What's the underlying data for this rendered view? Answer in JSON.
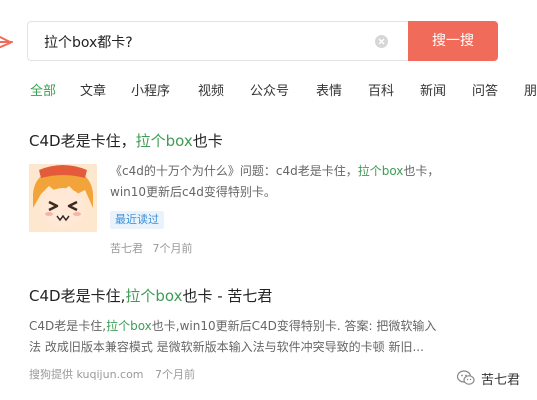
{
  "search": {
    "query": "拉个box都卡?",
    "button_label": "搜一搜"
  },
  "tabs": [
    {
      "label": "全部",
      "active": true
    },
    {
      "label": "文章"
    },
    {
      "label": "小程序"
    },
    {
      "label": "视频"
    },
    {
      "label": "公众号"
    },
    {
      "label": "表情"
    },
    {
      "label": "百科"
    },
    {
      "label": "新闻"
    },
    {
      "label": "问答"
    },
    {
      "label": "朋"
    }
  ],
  "results": [
    {
      "title_plain": "C4D老是卡住，",
      "title_hl": "拉个box",
      "title_tail": "也卡",
      "snippet_line1_a": "《c4d的十万个为什么》问题：c4d老是卡住，",
      "snippet_line1_hl": "拉个box",
      "snippet_line1_b": "也卡，",
      "snippet_line2": "win10更新后c4d变得特别卡。",
      "badge": "最近读过",
      "author": "苦七君",
      "time": "7个月前"
    },
    {
      "title_plain": "C4D老是卡住,",
      "title_hl": "拉个box",
      "title_tail": "也卡 - 苦七君",
      "snippet_line1_a": "C4D老是卡住,",
      "snippet_line1_hl": "拉个box",
      "snippet_line1_b": "也卡,win10更新后C4D变得特别卡. 答案: 把微软输入",
      "snippet_line2": "法 改成旧版本兼容模式 是微软新版本输入法与软件冲突导致的卡顿 新旧...",
      "source": "搜狗提供 kuqijun.com",
      "time": "7个月前"
    }
  ],
  "watermark": {
    "text": "苦七君"
  },
  "colors": {
    "accent": "#3aa14c",
    "button": "#f16b5b"
  }
}
